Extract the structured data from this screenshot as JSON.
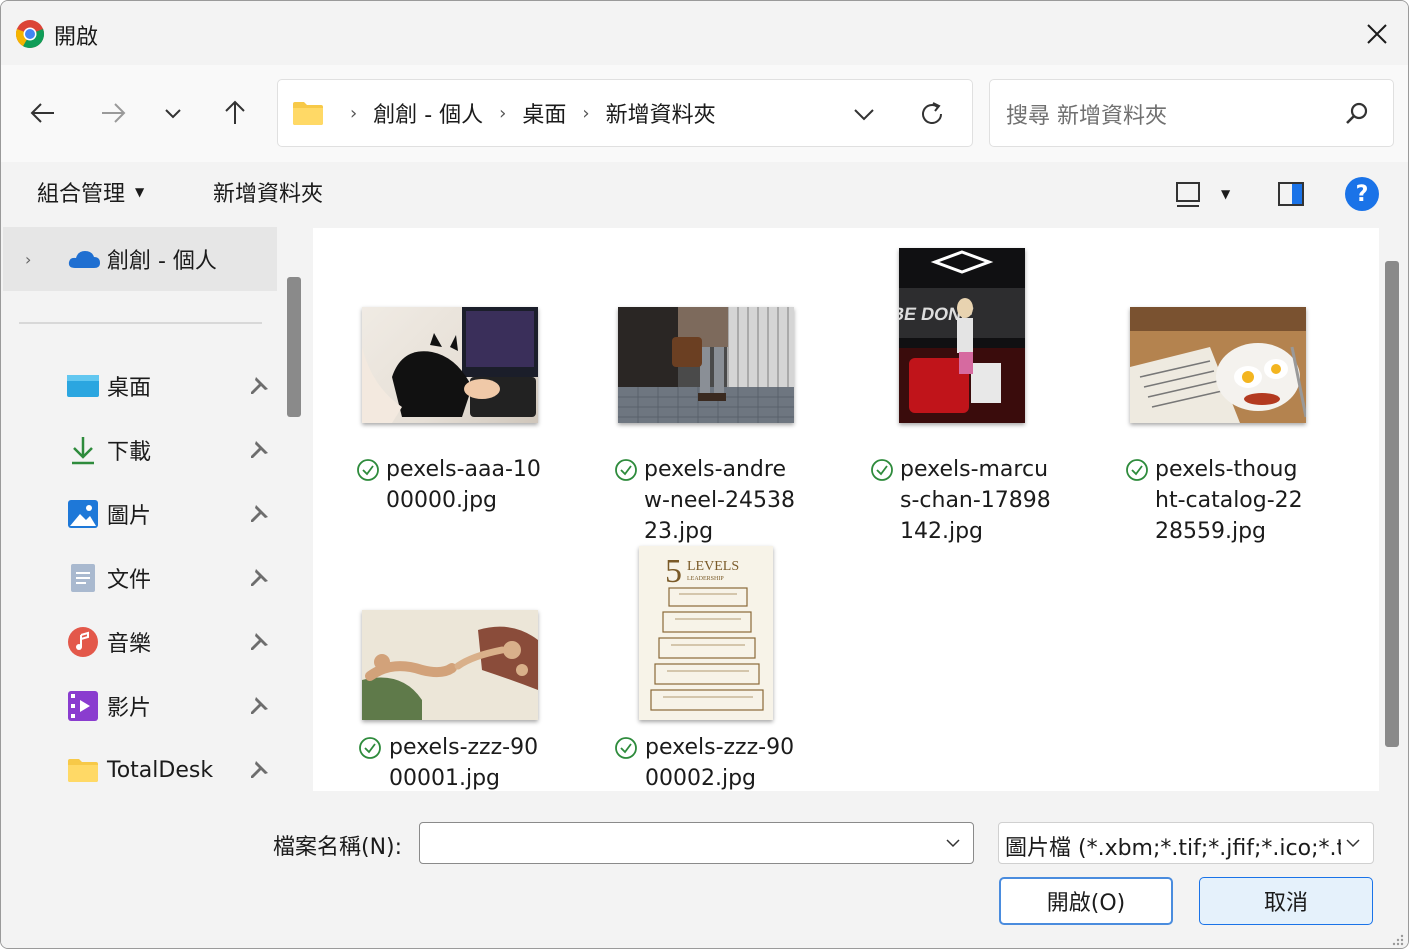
{
  "window": {
    "title": "開啟"
  },
  "address": {
    "crumbs": [
      "創創 - 個人",
      "桌面",
      "新增資料夾"
    ]
  },
  "search": {
    "placeholder": "搜尋 新增資料夾"
  },
  "toolbar": {
    "organize_label": "組合管理",
    "new_folder_label": "新增資料夾"
  },
  "sidebar": {
    "top_item": "創創 - 個人",
    "items": [
      {
        "label": "桌面",
        "icon": "desktop-icon"
      },
      {
        "label": "下載",
        "icon": "download-icon"
      },
      {
        "label": "圖片",
        "icon": "pictures-icon"
      },
      {
        "label": "文件",
        "icon": "documents-icon"
      },
      {
        "label": "音樂",
        "icon": "music-icon"
      },
      {
        "label": "影片",
        "icon": "videos-icon"
      },
      {
        "label": "TotalDesk",
        "icon": "folder-icon"
      }
    ]
  },
  "files": [
    {
      "name": "pexels-aaa-1000000.jpg",
      "line1": "pexels-aaa-10",
      "line2": "00000.jpg",
      "line3": ""
    },
    {
      "name": "pexels-andrew-neel-2453823.jpg",
      "line1": "pexels-andre",
      "line2": "w-neel-24538",
      "line3": "23.jpg"
    },
    {
      "name": "pexels-marcus-chan-17898142.jpg",
      "line1": "pexels-marcu",
      "line2": "s-chan-17898",
      "line3": "142.jpg"
    },
    {
      "name": "pexels-thought-catalog-2228559.jpg",
      "line1": "pexels-thoug",
      "line2": "ht-catalog-22",
      "line3": "28559.jpg"
    },
    {
      "name": "pexels-zzz-9000001.jpg",
      "line1": "pexels-zzz-90",
      "line2": "00001.jpg",
      "line3": ""
    },
    {
      "name": "pexels-zzz-9000002.jpg",
      "line1": "pexels-zzz-90",
      "line2": "00002.jpg",
      "line3": ""
    }
  ],
  "bottom": {
    "filename_label": "檔案名稱(N):",
    "filename_value": "",
    "filetype_value": "圖片檔 (*.xbm;*.tif;*.jfif;*.ico;*.t",
    "open_label": "開啟(O)",
    "cancel_label": "取消"
  },
  "book_cover": {
    "number": "5",
    "title": "LEVELS",
    "subtitle": "LEADERSHIP"
  },
  "colors": {
    "accent": "#1a73e8",
    "folder": "#f7c948",
    "onedrive": "#1f6fd1",
    "sync_ok": "#2e8b3c"
  }
}
